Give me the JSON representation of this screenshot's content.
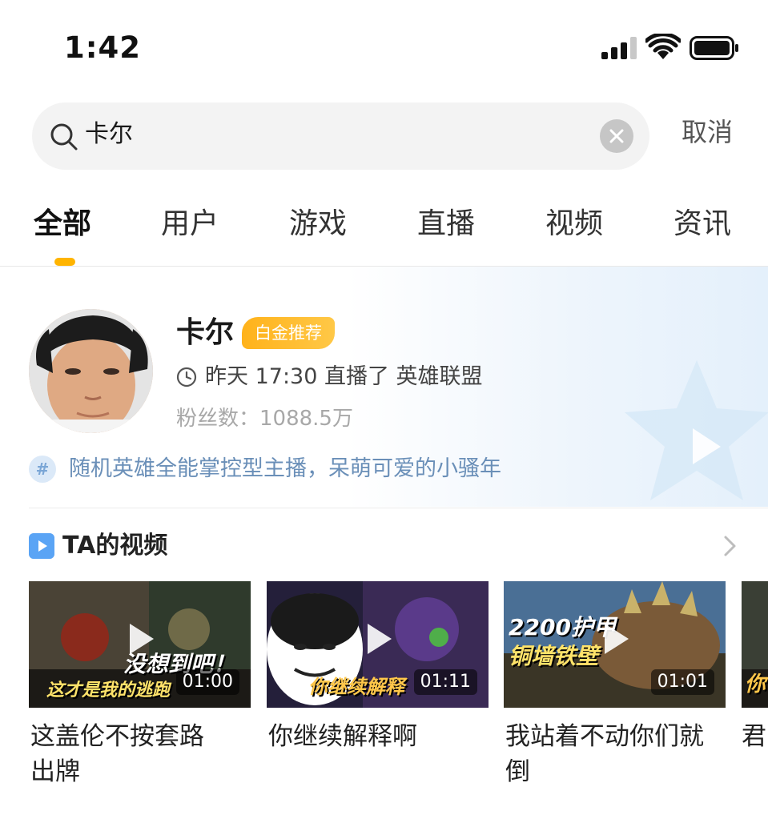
{
  "status_bar": {
    "time": "1:42"
  },
  "search": {
    "query": "卡尔",
    "cancel_label": "取消"
  },
  "tabs": [
    {
      "label": "全部",
      "active": true
    },
    {
      "label": "用户",
      "active": false
    },
    {
      "label": "游戏",
      "active": false
    },
    {
      "label": "直播",
      "active": false
    },
    {
      "label": "视频",
      "active": false
    },
    {
      "label": "资讯",
      "active": false
    }
  ],
  "user": {
    "name": "卡尔",
    "badge": "白金推荐",
    "last_live": "昨天 17:30 直播了 英雄联盟",
    "fans": "粉丝数：1088.5万",
    "description": "随机英雄全能掌控型主播，呆萌可爱的小骚年"
  },
  "videos_section": {
    "title": "TA的视频",
    "items": [
      {
        "caption_line1": "这盖伦不按套路",
        "caption_line2": "出牌",
        "duration": "01:00",
        "overlay_top": "没想到吧！",
        "overlay_bottom": "这才是我的逃跑"
      },
      {
        "caption_line1": "你继续解释啊",
        "caption_line2": "",
        "duration": "01:11",
        "overlay_top": "",
        "overlay_bottom": "你继续解释"
      },
      {
        "caption_line1": "我站着不动你们就",
        "caption_line2": "倒",
        "duration": "01:01",
        "overlay_top": "2200护甲",
        "overlay_bottom": "铜墙铁壁"
      },
      {
        "caption_line1": "君",
        "caption_line2": "",
        "duration": "",
        "overlay_top": "",
        "overlay_bottom": "你"
      }
    ]
  },
  "colors": {
    "accent": "#ffb400",
    "badge": "#ffb21a",
    "link_blue": "#6a8fb8"
  }
}
